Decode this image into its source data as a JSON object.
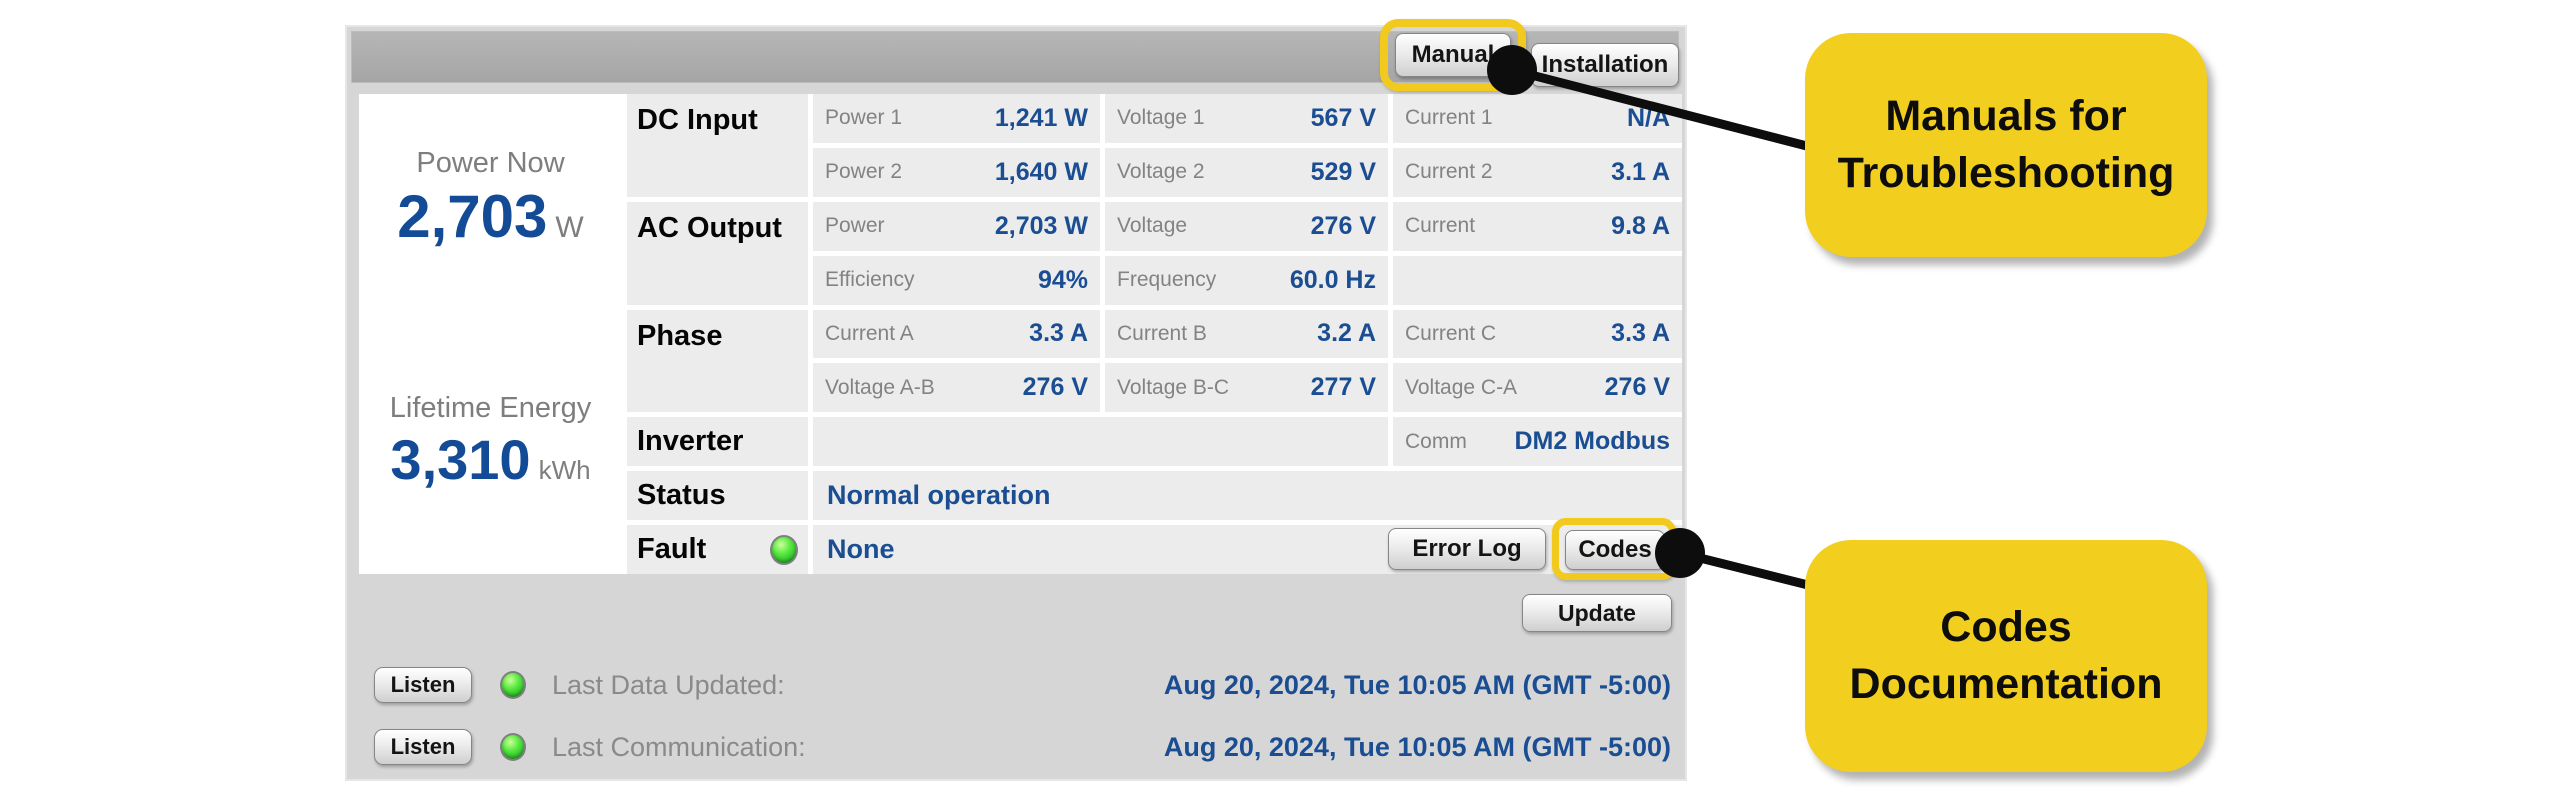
{
  "header": {
    "manual_label": "Manual",
    "installation_label": "Installation"
  },
  "summary": {
    "power_now": {
      "label": "Power Now",
      "value": "2,703",
      "unit": "W"
    },
    "lifetime_energy": {
      "label": "Lifetime Energy",
      "value": "3,310",
      "unit": "kWh"
    }
  },
  "sections": {
    "dc": "DC Input",
    "ac": "AC Output",
    "phase": "Phase",
    "inverter": "Inverter",
    "status": "Status",
    "fault": "Fault"
  },
  "cells": {
    "dc1": [
      {
        "label": "Power 1",
        "value": "1,241 W"
      },
      {
        "label": "Voltage 1",
        "value": "567 V"
      },
      {
        "label": "Current 1",
        "value": "N/A"
      }
    ],
    "dc2": [
      {
        "label": "Power 2",
        "value": "1,640 W"
      },
      {
        "label": "Voltage 2",
        "value": "529 V"
      },
      {
        "label": "Current 2",
        "value": "3.1 A"
      }
    ],
    "ac1": [
      {
        "label": "Power",
        "value": "2,703 W"
      },
      {
        "label": "Voltage",
        "value": "276 V"
      },
      {
        "label": "Current",
        "value": "9.8 A"
      }
    ],
    "ac2": [
      {
        "label": "Efficiency",
        "value": "94%"
      },
      {
        "label": "Frequency",
        "value": "60.0 Hz"
      }
    ],
    "phase1": [
      {
        "label": "Current A",
        "value": "3.3 A"
      },
      {
        "label": "Current B",
        "value": "3.2 A"
      },
      {
        "label": "Current C",
        "value": "3.3 A"
      }
    ],
    "phase2": [
      {
        "label": "Voltage A-B",
        "value": "276 V"
      },
      {
        "label": "Voltage B-C",
        "value": "277 V"
      },
      {
        "label": "Voltage C-A",
        "value": "276 V"
      }
    ],
    "comm": {
      "label": "Comm",
      "value": "DM2 Modbus"
    }
  },
  "status_value": "Normal operation",
  "fault_value": "None",
  "buttons": {
    "error_log": "Error Log",
    "codes": "Codes",
    "update": "Update",
    "listen": "Listen"
  },
  "footer": [
    {
      "label": "Last Data Updated:",
      "value": "Aug 20, 2024, Tue 10:05 AM (GMT -5:00)"
    },
    {
      "label": "Last Communication:",
      "value": "Aug 20, 2024, Tue 10:05 AM (GMT -5:00)"
    }
  ],
  "annotations": {
    "manuals": {
      "line1": "Manuals for",
      "line2": "Troubleshooting"
    },
    "codes": {
      "line1": "Codes",
      "line2": "Documentation"
    }
  },
  "colors": {
    "highlight_yellow": "#f2ce1f",
    "value_blue": "#1a4d92",
    "led_green": "#3fdc3f"
  }
}
